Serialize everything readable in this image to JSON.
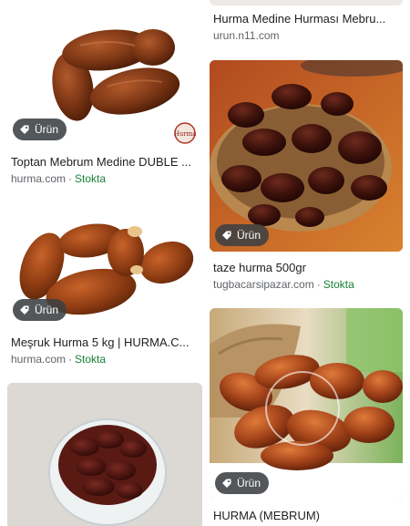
{
  "badge_label": "Ürün",
  "left": [
    {
      "title": "Toptan Mebrum Medine DUBLE ...",
      "source": "hurma.com",
      "stock": "Stokta",
      "watermark": "Hurma"
    },
    {
      "title": "Meşruk Hurma 5 kg | HURMA.C...",
      "source": "hurma.com",
      "stock": "Stokta"
    },
    {
      "title": ""
    }
  ],
  "right": [
    {
      "title": "Hurma Medine Hurması Mebru...",
      "source": "urun.n11.com"
    },
    {
      "title": "taze hurma 500gr",
      "source": "tugbacarsipazar.com",
      "stock": "Stokta"
    },
    {
      "title": "HURMA (MEBRUM)"
    }
  ],
  "colors": {
    "stock_green": "#188038",
    "badge_bg": "#3c4043",
    "date_brown": "#6b2f12"
  }
}
